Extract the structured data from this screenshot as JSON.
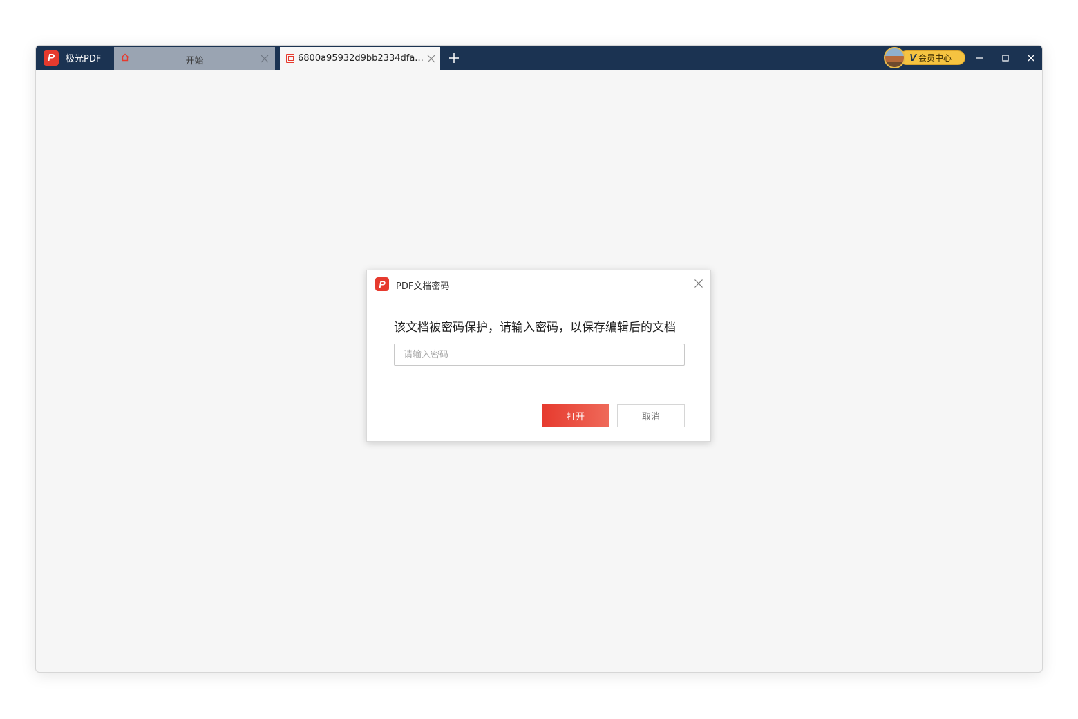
{
  "app": {
    "name": "极光PDF",
    "logo_letter": "P",
    "accent": "#e63a2e",
    "titlebar_bg": "#1b3352"
  },
  "tabs": [
    {
      "label": "开始",
      "icon": "home-icon",
      "active": false
    },
    {
      "label": "6800a95932d9bb2334dfa...",
      "icon": "pdf-file-icon",
      "active": true
    }
  ],
  "vip": {
    "badge": "V",
    "label": "会员中心"
  },
  "dialog": {
    "title": "PDF文档密码",
    "message": "该文档被密码保护，请输入密码，以保存编辑后的文档",
    "password_placeholder": "请输入密码",
    "password_value": "",
    "open_label": "打开",
    "cancel_label": "取消"
  }
}
